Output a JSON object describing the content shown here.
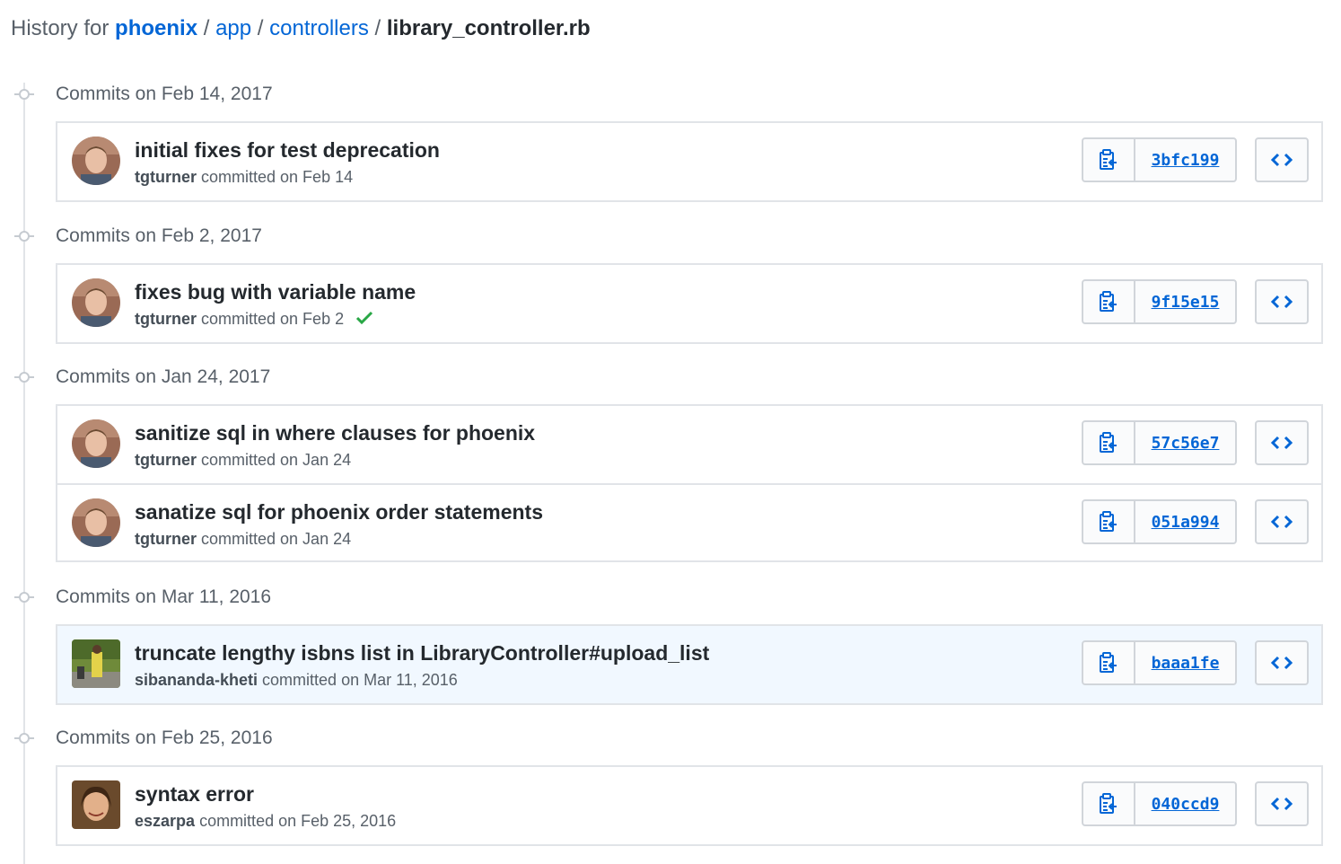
{
  "breadcrumb": {
    "prefix": "History for",
    "repo": "phoenix",
    "sep": "/",
    "dir1": "app",
    "dir2": "controllers",
    "file": "library_controller.rb"
  },
  "groups": [
    {
      "title": "Commits on Feb 14, 2017",
      "commits": [
        {
          "title": "initial fixes for test deprecation",
          "author": "tgturner",
          "when": "committed on Feb 14",
          "sha": "3bfc199",
          "verified": false
        }
      ]
    },
    {
      "title": "Commits on Feb 2, 2017",
      "commits": [
        {
          "title": "fixes bug with variable name",
          "author": "tgturner",
          "when": "committed on Feb 2",
          "sha": "9f15e15",
          "verified": true
        }
      ]
    },
    {
      "title": "Commits on Jan 24, 2017",
      "commits": [
        {
          "title": "sanitize sql in where clauses for phoenix",
          "author": "tgturner",
          "when": "committed on Jan 24",
          "sha": "57c56e7",
          "verified": false
        },
        {
          "title": "sanatize sql for phoenix order statements",
          "author": "tgturner",
          "when": "committed on Jan 24",
          "sha": "051a994",
          "verified": false
        }
      ]
    },
    {
      "title": "Commits on Mar 11, 2016",
      "commits": [
        {
          "title": "truncate lengthy isbns list in LibraryController#upload_list",
          "author": "sibananda-kheti",
          "when": "committed on Mar 11, 2016",
          "sha": "baaa1fe",
          "verified": false
        }
      ]
    },
    {
      "title": "Commits on Feb 25, 2016",
      "commits": [
        {
          "title": "syntax error",
          "author": "eszarpa",
          "when": "committed on Feb 25, 2016",
          "sha": "040ccd9",
          "verified": false
        }
      ]
    }
  ],
  "icons": {
    "commit_dot": "git-commit-icon",
    "copy": "clippy-icon",
    "browse": "code-icon",
    "check": "check-icon"
  },
  "colors": {
    "link": "#0366d6",
    "success": "#28a745",
    "highlight_row": "#f1f8ff"
  }
}
